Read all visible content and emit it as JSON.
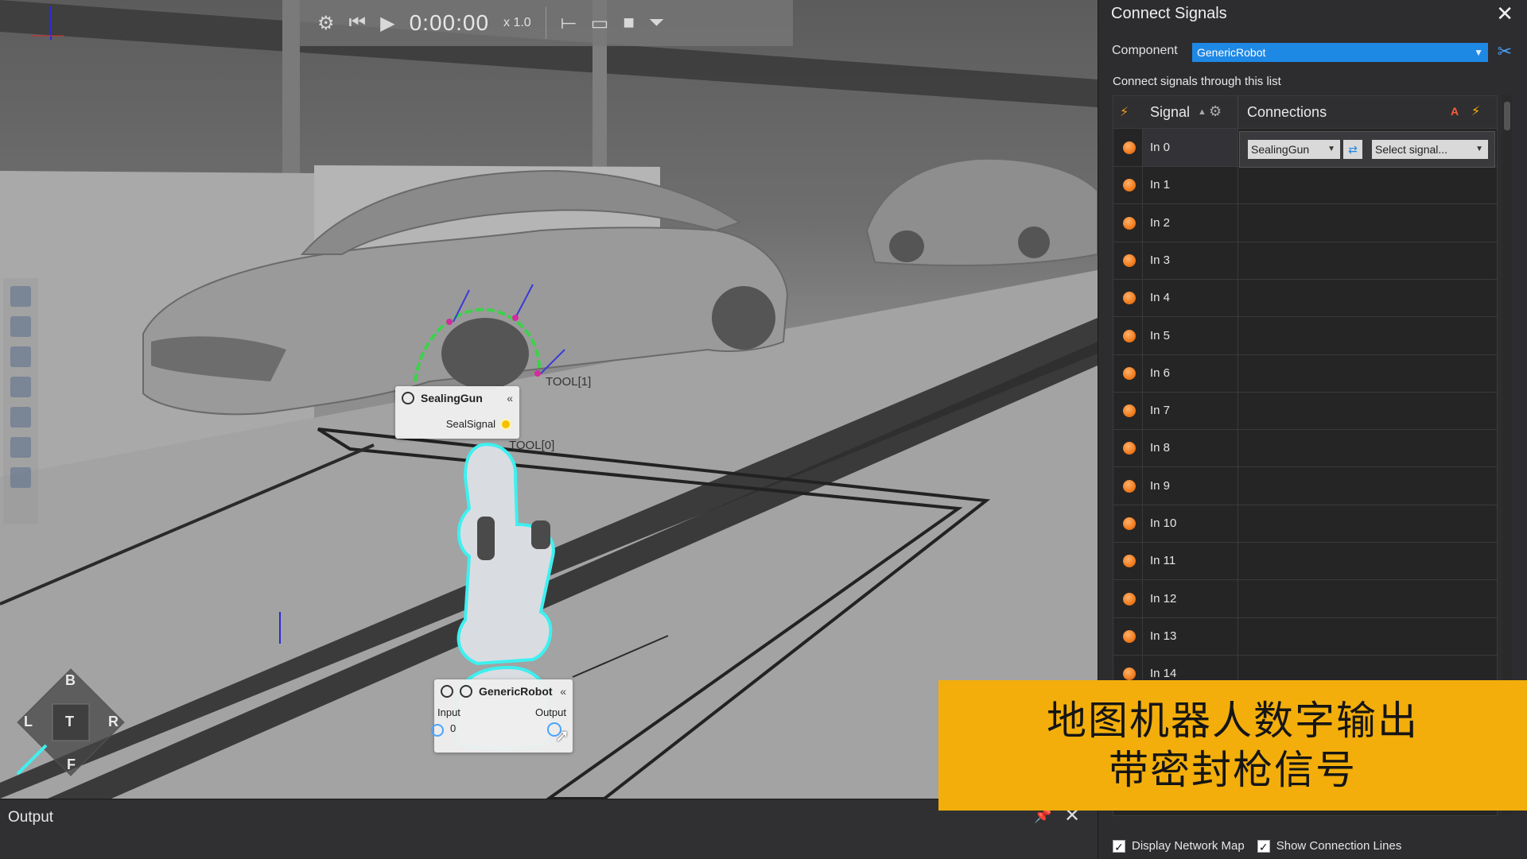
{
  "viewport": {
    "playback": {
      "time": "0:00:00",
      "speed": "x 1.0"
    },
    "nav_cube": {
      "top": "B",
      "center": "T",
      "left": "L",
      "right": "R",
      "bottom": "F"
    },
    "scene_labels": {
      "tool1": "TOOL[1]",
      "tool0": "TOOL[0]"
    },
    "nodes": {
      "sealing_gun": {
        "title": "SealingGun",
        "signal": "SealSignal",
        "collapse": "«"
      },
      "generic_robot": {
        "title": "GenericRobot",
        "input_label": "Input",
        "output_label": "Output",
        "input_value": "0",
        "collapse": "«"
      }
    }
  },
  "output_bar": {
    "title": "Output"
  },
  "panel": {
    "title": "Connect Signals",
    "component_label": "Component",
    "component_value": "GenericRobot",
    "hint": "Connect signals through this list",
    "columns": {
      "signal": "Signal",
      "connections": "Connections",
      "a": "A"
    },
    "rows": [
      "In 0",
      "In 1",
      "In 2",
      "In 3",
      "In 4",
      "In 5",
      "In 6",
      "In 7",
      "In 8",
      "In 9",
      "In 10",
      "In 11",
      "In 12",
      "In 13",
      "In 14"
    ],
    "connection_editor": {
      "component": "SealingGun",
      "signal_placeholder": "Select signal..."
    },
    "options": {
      "display_network_map": "Display Network Map",
      "show_connection_lines": "Show Connection Lines"
    }
  },
  "caption": {
    "line1": "地图机器人数字输出",
    "line2": "带密封枪信号"
  },
  "colors": {
    "accent": "#1e88e5",
    "signal_dot": "#f07c1e",
    "caption_bg": "#f3ae0b",
    "selection_glow": "#3ef0f0"
  }
}
